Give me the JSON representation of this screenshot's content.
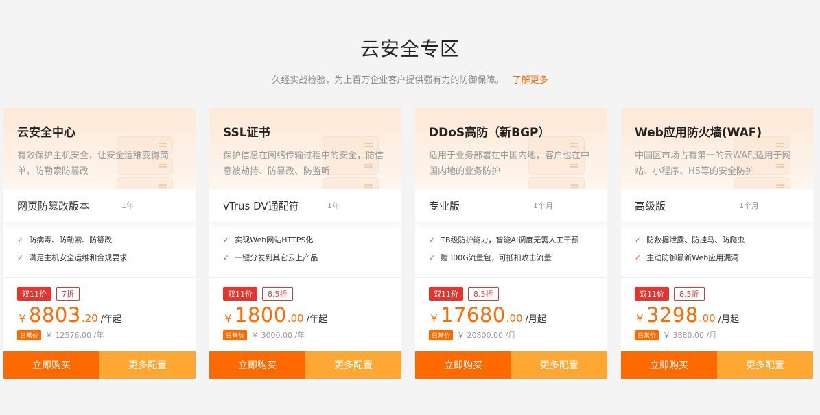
{
  "section": {
    "title": "云安全专区",
    "subtitle": "久经实战检验，为上百万企业客户提供强有力的防御保障。",
    "learn_more": "了解更多"
  },
  "colors": {
    "accent": "#ff6a00",
    "accent_light": "#ffa733",
    "promo_red": "#e3342f"
  },
  "cards": [
    {
      "name": "云安全中心",
      "desc": "有效保护主机安全，让安全运维变得简单，防勒索防篡改",
      "plan": "网页防篡改版本",
      "term": "1年",
      "features": [
        "防病毒、防勒索、防篡改",
        "满足主机安全运维和合规要求"
      ],
      "promo": "双11价",
      "discount": "7折",
      "currency": "￥",
      "price_int": "8803",
      "price_dec": ".20",
      "unit": "/年起",
      "regular_label": "日常价",
      "orig_price": "￥ 12576.00 /年",
      "buy": "立即购买",
      "config": "更多配置"
    },
    {
      "name": "SSL证书",
      "desc": "保护信息在网络传输过程中的安全，防信息被劫持、防篡改、防监听",
      "plan": "vTrus DV通配符",
      "term": "1年",
      "features": [
        "实现Web网站HTTPS化",
        "一键分发到其它云上产品"
      ],
      "promo": "双11价",
      "discount": "8.5折",
      "currency": "￥",
      "price_int": "1800",
      "price_dec": ".00",
      "unit": "/年起",
      "regular_label": "日常价",
      "orig_price": "￥ 3000.00 /年",
      "buy": "立即购买",
      "config": "更多配置"
    },
    {
      "name": "DDoS高防（新BGP）",
      "desc": "适用于业务部署在中国内地，客户也在中国内地的业务防护",
      "plan": "专业版",
      "term": "1个月",
      "features": [
        "TB级防护能力，智能AI调度无需人工干预",
        "赠300G流量包，可抵扣攻击流量"
      ],
      "promo": "双11价",
      "discount": "8.5折",
      "currency": "￥",
      "price_int": "17680",
      "price_dec": ".00",
      "unit": "/月起",
      "regular_label": "日常价",
      "orig_price": "￥ 20800.00 /月",
      "buy": "立即购买",
      "config": "更多配置"
    },
    {
      "name": "Web应用防火墙(WAF)",
      "desc": "中国区市场占有第一的云WAF,适用于网站、小程序、H5等的安全防护",
      "plan": "高级版",
      "term": "1个月",
      "features": [
        "防数据泄露、防挂马、防爬虫",
        "主动防御最新Web应用漏洞"
      ],
      "promo": "双11价",
      "discount": "8.5折",
      "currency": "￥",
      "price_int": "3298",
      "price_dec": ".00",
      "unit": "/月起",
      "regular_label": "日常价",
      "orig_price": "￥ 3880.00 /月",
      "buy": "立即购买",
      "config": "更多配置"
    }
  ]
}
